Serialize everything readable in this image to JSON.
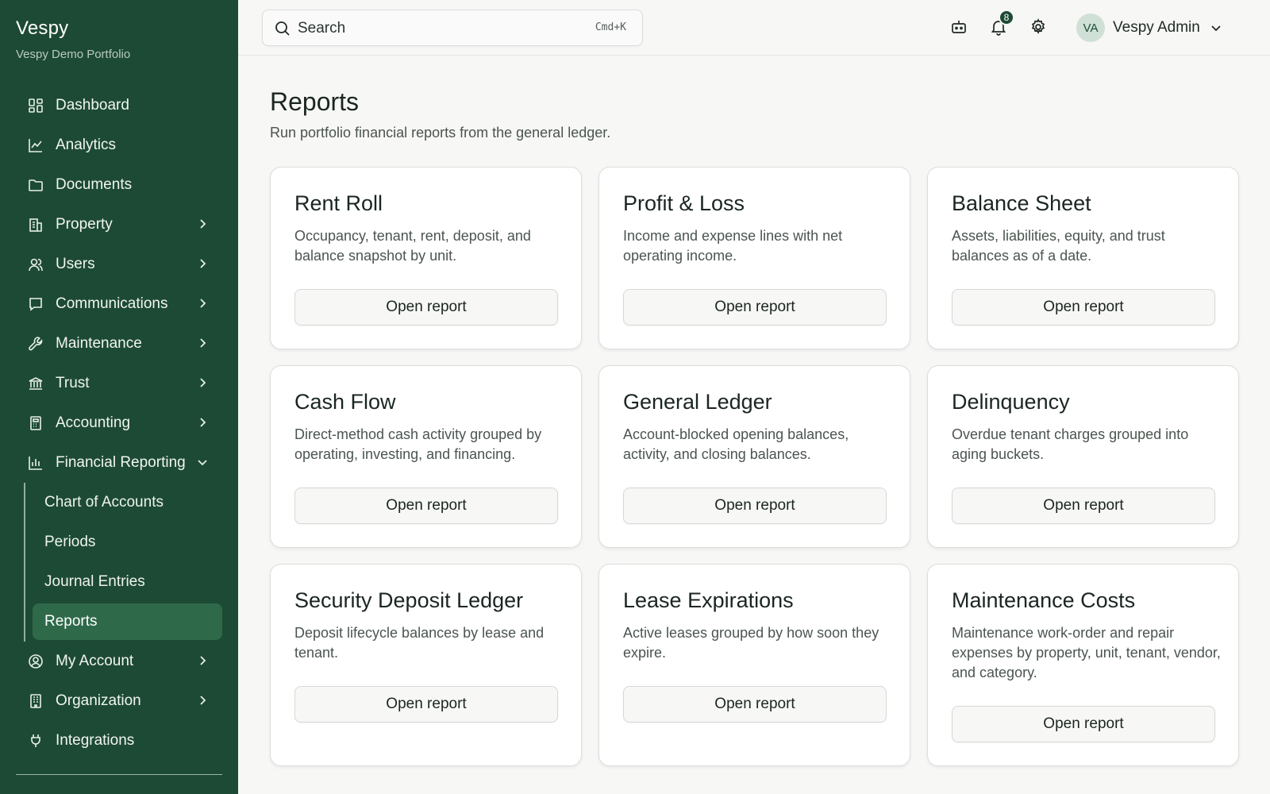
{
  "sidebar": {
    "brand": "Vespy",
    "portfolio": "Vespy Demo Portfolio",
    "items": [
      {
        "label": "Dashboard",
        "icon": "dashboard-icon"
      },
      {
        "label": "Analytics",
        "icon": "chart-line-icon"
      },
      {
        "label": "Documents",
        "icon": "folder-icon"
      },
      {
        "label": "Property",
        "icon": "building-icon"
      },
      {
        "label": "Users",
        "icon": "users-icon"
      },
      {
        "label": "Communications",
        "icon": "message-icon"
      },
      {
        "label": "Maintenance",
        "icon": "wrench-icon"
      },
      {
        "label": "Trust",
        "icon": "bank-icon"
      },
      {
        "label": "Accounting",
        "icon": "calculator-icon"
      },
      {
        "label": "Financial Reporting",
        "icon": "bar-chart-icon"
      }
    ],
    "sub_items": [
      {
        "label": "Chart of Accounts"
      },
      {
        "label": "Periods"
      },
      {
        "label": "Journal Entries"
      },
      {
        "label": "Reports"
      }
    ],
    "bottom_items": [
      {
        "label": "My Account",
        "icon": "account-circle-icon"
      },
      {
        "label": "Organization",
        "icon": "office-icon"
      },
      {
        "label": "Integrations",
        "icon": "plug-icon"
      }
    ]
  },
  "topbar": {
    "search_placeholder": "Search",
    "shortcut": "Cmd+K",
    "notification_count": "8",
    "user_initials": "VA",
    "user_name": "Vespy Admin"
  },
  "page": {
    "title": "Reports",
    "subtitle": "Run portfolio financial reports from the general ledger."
  },
  "reports": [
    {
      "title": "Rent Roll",
      "description": "Occupancy, tenant, rent, deposit, and balance snapshot by unit.",
      "button": "Open report"
    },
    {
      "title": "Profit & Loss",
      "description": "Income and expense lines with net operating income.",
      "button": "Open report"
    },
    {
      "title": "Balance Sheet",
      "description": "Assets, liabilities, equity, and trust balances as of a date.",
      "button": "Open report"
    },
    {
      "title": "Cash Flow",
      "description": "Direct-method cash activity grouped by operating, investing, and financing.",
      "button": "Open report"
    },
    {
      "title": "General Ledger",
      "description": "Account-blocked opening balances, activity, and closing balances.",
      "button": "Open report"
    },
    {
      "title": "Delinquency",
      "description": "Overdue tenant charges grouped into aging buckets.",
      "button": "Open report"
    },
    {
      "title": "Security Deposit Ledger",
      "description": "Deposit lifecycle balances by lease and tenant.",
      "button": "Open report"
    },
    {
      "title": "Lease Expirations",
      "description": "Active leases grouped by how soon they expire.",
      "button": "Open report"
    },
    {
      "title": "Maintenance Costs",
      "description": "Maintenance work-order and repair expenses by property, unit, tenant, vendor, and category.",
      "button": "Open report"
    }
  ],
  "colors": {
    "sidebar": "#1d4a34",
    "active": "#2e6a4a"
  }
}
